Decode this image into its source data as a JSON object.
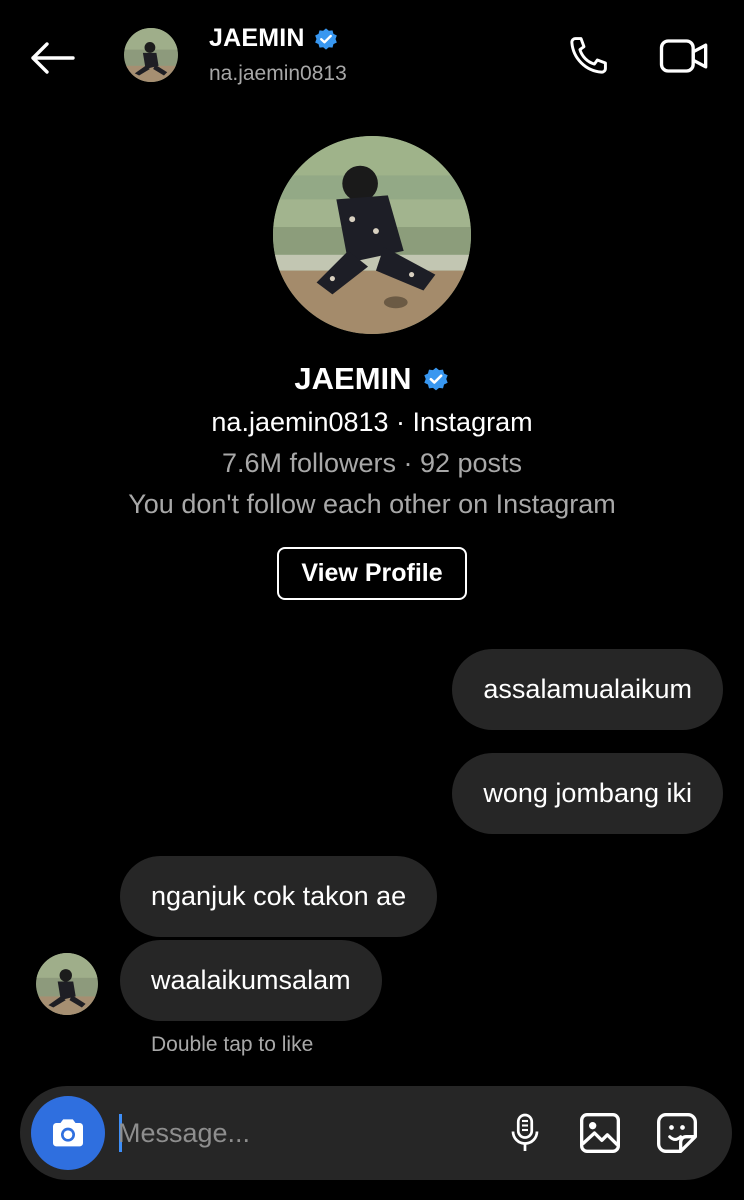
{
  "header": {
    "name": "JAEMIN",
    "handle": "na.jaemin0813",
    "icons": {
      "back": "arrow-left-icon",
      "call": "phone-icon",
      "video": "video-camera-icon",
      "verified": "verified-badge-icon"
    }
  },
  "profile": {
    "name": "JAEMIN",
    "handle_line": "na.jaemin0813 · Instagram",
    "stats_line": "7.6M followers · 92 posts",
    "relationship_line": "You don't follow each other on Instagram",
    "view_profile_label": "View Profile"
  },
  "messages": [
    {
      "from": "me",
      "text": "assalamualaikum"
    },
    {
      "from": "me",
      "text": "wong jombang iki"
    },
    {
      "from": "them",
      "text": "nganjuk cok takon ae"
    },
    {
      "from": "them",
      "text": "waalaikumsalam"
    }
  ],
  "hint": "Double tap to like",
  "composer": {
    "placeholder": "Message...",
    "icons": [
      "camera-icon",
      "microphone-icon",
      "gallery-icon",
      "sticker-icon"
    ]
  },
  "colors": {
    "background": "#000000",
    "bubble": "#262626",
    "verified": "#3897f0",
    "camera_button": "#2f6fdf",
    "secondary_text": "#a8a8a8"
  }
}
